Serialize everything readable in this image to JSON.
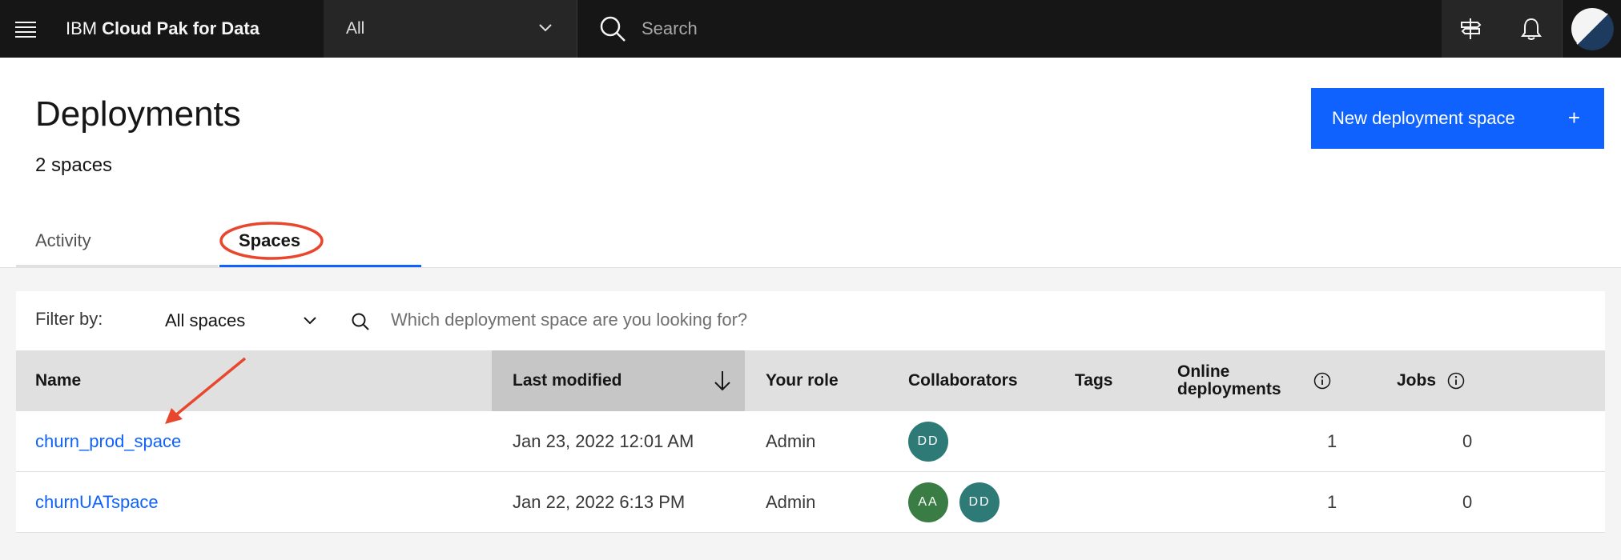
{
  "header": {
    "brand_prefix": "IBM",
    "brand_name": "Cloud Pak for Data",
    "scope_value": "All",
    "search_placeholder": "Search"
  },
  "page": {
    "title": "Deployments",
    "subtitle": "2 spaces",
    "new_button_label": "New deployment space",
    "new_button_plus": "+"
  },
  "tabs": [
    {
      "label": "Activity",
      "selected": false
    },
    {
      "label": "Spaces",
      "selected": true
    }
  ],
  "filter": {
    "label": "Filter by:",
    "selected_value": "All spaces",
    "search_placeholder": "Which deployment space are you looking for?"
  },
  "table": {
    "columns": {
      "name": "Name",
      "last_modified": "Last modified",
      "your_role": "Your role",
      "collaborators": "Collaborators",
      "tags": "Tags",
      "online_deployments_1": "Online",
      "online_deployments_2": "deployments",
      "jobs": "Jobs"
    },
    "rows": [
      {
        "name": "churn_prod_space",
        "last_modified": "Jan 23, 2022 12:01 AM",
        "role": "Admin",
        "collaborators": [
          "DD"
        ],
        "tags": "",
        "online_deployments": "1",
        "jobs": "0"
      },
      {
        "name": "churnUATspace",
        "last_modified": "Jan 22, 2022 6:13 PM",
        "role": "Admin",
        "collaborators": [
          "AA",
          "DD"
        ],
        "tags": "",
        "online_deployments": "1",
        "jobs": "0"
      }
    ]
  },
  "colors": {
    "accent": "#0f62fe",
    "annotation": "#e8462d",
    "badge_aa": "#3a7d44",
    "badge_dd": "#2e7a77"
  }
}
